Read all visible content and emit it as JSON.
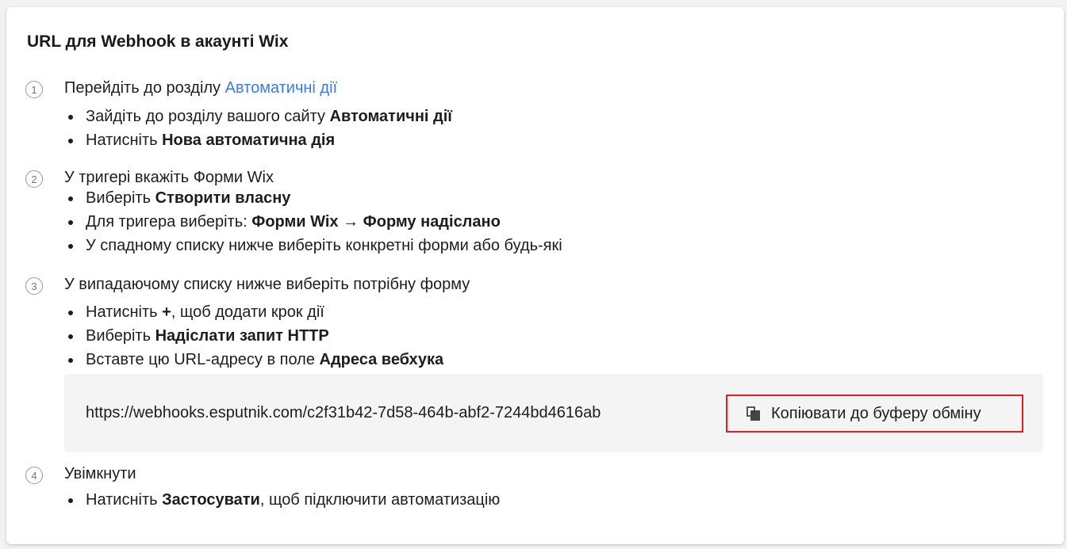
{
  "title": "URL для Webhook в акаунті Wix",
  "steps": [
    {
      "num": "1",
      "title_prefix": "Перейдіть до розділу ",
      "title_link": "Автоматичні дії",
      "bullets": [
        {
          "pre": "Зайдіть до розділу вашого сайту ",
          "bold": "Автоматичні дії",
          "post": ""
        },
        {
          "pre": "Натисніть ",
          "bold": "Нова автоматична дія",
          "post": ""
        }
      ]
    },
    {
      "num": "2",
      "title": "У тригері вкажіть Форми Wix",
      "bullets": [
        {
          "pre": "Виберіть ",
          "bold": "Створити власну",
          "post": ""
        },
        {
          "pre": "Для тригера виберіть: ",
          "bold": "Форми Wix",
          "mid": " → ",
          "bold2": "Форму надіслано",
          "post": ""
        },
        {
          "pre": "У спадному списку нижче виберіть конкретні форми або будь-які",
          "bold": "",
          "post": ""
        }
      ]
    },
    {
      "num": "3",
      "title": "У випадаючому списку нижче виберіть потрібну форму",
      "bullets": [
        {
          "pre": "Натисніть ",
          "bold": "+",
          "post": ", щоб додати крок дії"
        },
        {
          "pre": "Виберіть ",
          "bold": "Надіслати запит HTTP",
          "post": ""
        },
        {
          "pre": "Вставте цю URL-адресу в поле ",
          "bold": "Адреса вебхука",
          "post": ""
        }
      ]
    },
    {
      "num": "4",
      "title": "Увімкнути",
      "bullets": [
        {
          "pre": "Натисніть ",
          "bold": "Застосувати",
          "post": ", щоб підключити автоматизацію"
        }
      ]
    }
  ],
  "webhook": {
    "url": "https://webhooks.esputnik.com/c2f31b42-7d58-464b-abf2-7244bd4616ab",
    "copy_label": "Копіювати до буферу обміну",
    "copy_icon": "copy-icon"
  },
  "colors": {
    "link": "#3a7be0",
    "highlight_border": "#e0201e",
    "url_box_bg": "#f4f4f4"
  }
}
